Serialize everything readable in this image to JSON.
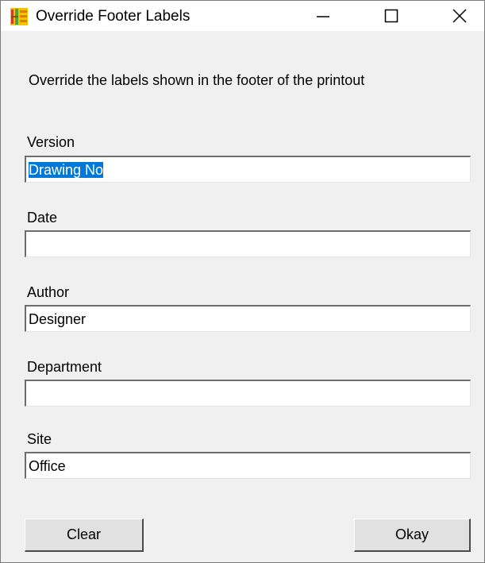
{
  "window": {
    "title": "Override Footer Labels",
    "icon": "app-icon"
  },
  "description": "Override the labels shown in the footer of the printout",
  "fields": [
    {
      "label": "Version",
      "value": "Drawing No",
      "selected": true
    },
    {
      "label": "Date",
      "value": ""
    },
    {
      "label": "Author",
      "value": "Designer"
    },
    {
      "label": "Department",
      "value": ""
    },
    {
      "label": "Site",
      "value": "Office"
    }
  ],
  "buttons": {
    "clear": "Clear",
    "okay": "Okay"
  },
  "colors": {
    "selection": "#0078d7",
    "dialog_background": "#f0f0f0"
  }
}
